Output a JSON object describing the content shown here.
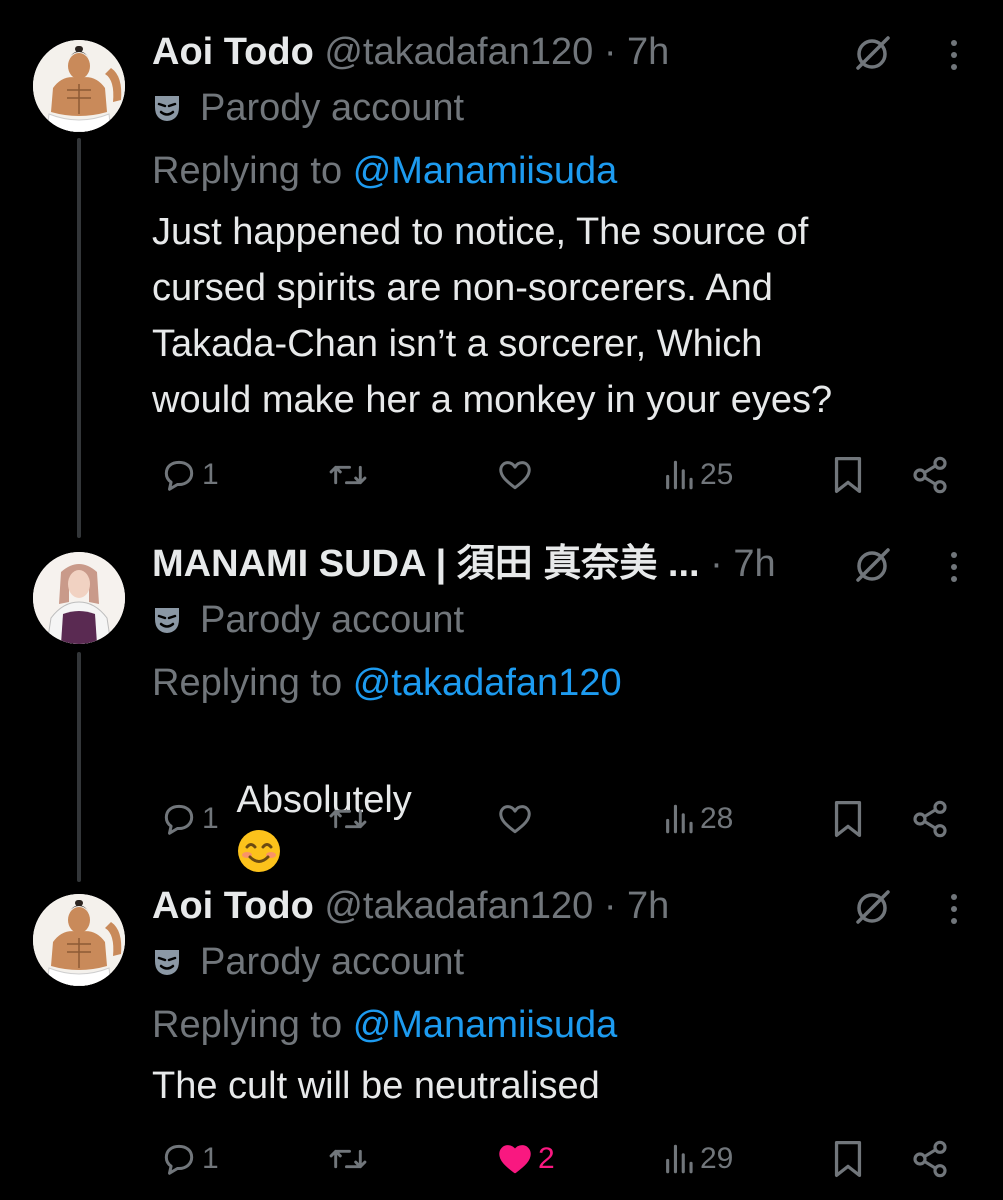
{
  "tweets": [
    {
      "display_name": "Aoi Todo",
      "handle": "@takadafan120",
      "separator": "·",
      "time": "7h",
      "badge": "Parody account",
      "replying_label": "Replying to",
      "replying_to": "@Manamiisuda",
      "text": "Just happened to notice, The source of\ncursed spirits are non-sorcerers. And\nTakada-Chan isn’t a sorcerer, Which\nwould make her a monkey in your eyes?",
      "replies": "1",
      "reposts": "",
      "likes": "",
      "views": "25",
      "avatar": "muscular-anime-character-avatar"
    },
    {
      "display_name": "MANAMI SUDA | 須田 真奈美",
      "name_ellipsis": "...",
      "handle": "",
      "separator": "·",
      "time": "7h",
      "badge": "Parody account",
      "replying_label": "Replying to",
      "replying_to": "@takadafan120",
      "text": "Absolutely",
      "emoji": "smiling-face-emoji",
      "replies": "1",
      "reposts": "",
      "likes": "",
      "views": "28",
      "avatar": "anime-woman-purple-top-avatar"
    },
    {
      "display_name": "Aoi Todo",
      "handle": "@takadafan120",
      "separator": "·",
      "time": "7h",
      "badge": "Parody account",
      "replying_label": "Replying to",
      "replying_to": "@Manamiisuda",
      "text": "The cult will be neutralised",
      "replies": "1",
      "reposts": "",
      "likes": "2",
      "liked": true,
      "views": "29",
      "avatar": "muscular-anime-character-avatar"
    }
  ],
  "colors": {
    "background": "#000000",
    "primary_text": "#e7e9ea",
    "secondary_text": "#71767b",
    "link": "#1d9bf0",
    "like_active": "#f91880",
    "thread_line": "#333639"
  }
}
